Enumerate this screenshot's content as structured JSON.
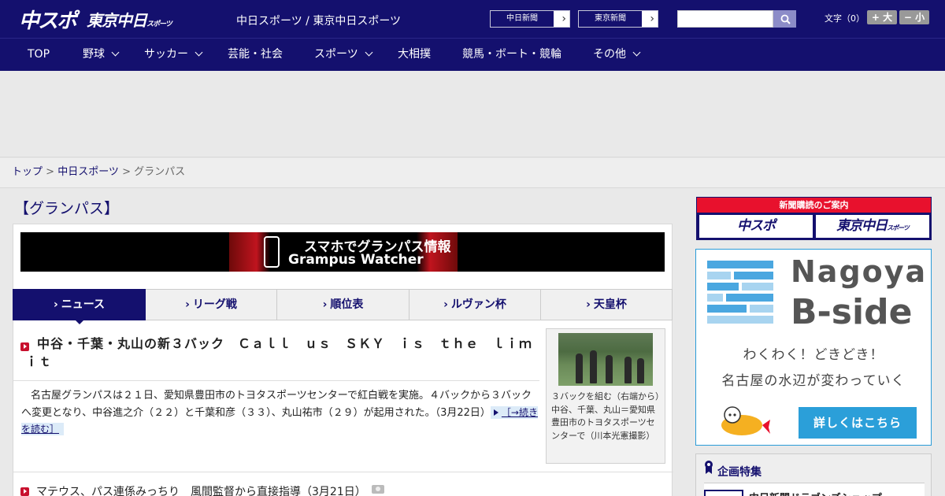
{
  "header": {
    "logo_chuspo": "中スポ",
    "logo_tokyo": "東京中日",
    "logo_tokyo_small": "スポーツ",
    "site_title": "中日スポーツ / 東京中日スポーツ",
    "chunichi_btn": "中日新聞",
    "tokyo_btn": "東京新聞",
    "search_placeholder": "",
    "fontsize_label": "文字（0）",
    "fontsize_up": "+ 大",
    "fontsize_down": "− 小"
  },
  "nav": {
    "items": [
      {
        "label": "TOP",
        "dropdown": false
      },
      {
        "label": "野球",
        "dropdown": true
      },
      {
        "label": "サッカー",
        "dropdown": true
      },
      {
        "label": "芸能・社会",
        "dropdown": false
      },
      {
        "label": "スポーツ",
        "dropdown": true
      },
      {
        "label": "大相撲",
        "dropdown": false
      },
      {
        "label": "競馬・ボート・競輪",
        "dropdown": false
      },
      {
        "label": "その他",
        "dropdown": true
      }
    ]
  },
  "breadcrumb": {
    "home": "トップ",
    "sep": " > ",
    "section": "中日スポーツ",
    "current": "グランパス"
  },
  "main": {
    "heading": "【グランパス】",
    "banner_line1": "スマホでグランパス情報",
    "banner_line2": "Grampus Watcher",
    "tabs": [
      {
        "label": "ニュース",
        "active": true
      },
      {
        "label": "リーグ戦",
        "active": false
      },
      {
        "label": "順位表",
        "active": false
      },
      {
        "label": "ルヴァン杯",
        "active": false
      },
      {
        "label": "天皇杯",
        "active": false
      }
    ],
    "tab_chevron": "›",
    "headline": "中谷・千葉・丸山の新３バック　Ｃａｌｌ　ｕｓ　ＳＫＹ　ｉｓ　ｔｈｅ　ｌｉｍｉｔ",
    "lead": "名古屋グランパスは２１日、愛知県豊田市のトヨタスポーツセンターで紅白戦を実施。４バックから３バックへ変更となり、中谷進之介（２２）と千葉和彦（３３）、丸山祐市（２９）が起用された。（3月22日）",
    "more_link": "［→続きを読む］",
    "photo_caption": "３バックを組む（右端から）中谷、千葉、丸山＝愛知県豊田市のトヨタスポーツセンターで（川本光憲撮影）",
    "list_item_1": "マテウス、パス連係みっちり　風間監督から直接指導（3月21日）"
  },
  "sidebar": {
    "subscription_header": "新聞購読のご案内",
    "sub_chuspo": "中スポ",
    "sub_tokyo": "東京中日",
    "sub_tokyo_small": "スポーツ",
    "bside_title1": "Nagoya",
    "bside_title2": "B-side",
    "bside_tag1": "わくわく！どきどき！",
    "bside_tag2": "名古屋の水辺が変わっていく",
    "bside_btn": "詳しくはこちら",
    "kikaku_title": "企画特集",
    "kikaku_item": "中日新聞ドラゴンズショップ"
  },
  "colors": {
    "brand_navy": "#14106e",
    "accent_red": "#e8112d",
    "bside_blue": "#2b9fd9"
  }
}
